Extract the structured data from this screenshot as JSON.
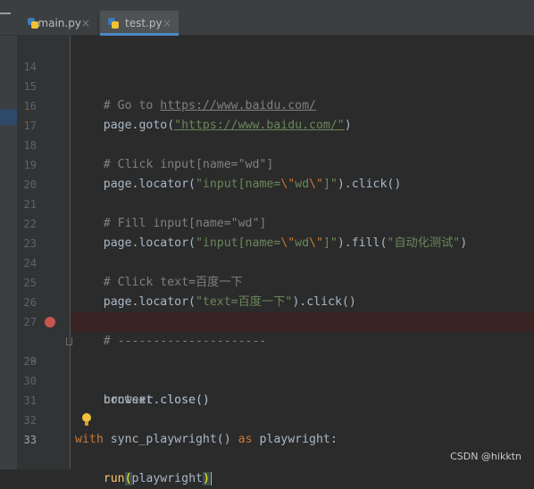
{
  "tabs": [
    {
      "label": "main.py",
      "close": "×",
      "icon": "python-file-icon"
    },
    {
      "label": "test.py",
      "close": "×",
      "icon": "python-file-icon",
      "active": true
    }
  ],
  "editor": {
    "line_numbers": [
      "14",
      "15",
      "16",
      "17",
      "18",
      "19",
      "20",
      "21",
      "22",
      "23",
      "24",
      "25",
      "26",
      "27",
      "28",
      "29",
      "30",
      "31",
      "32",
      "33"
    ],
    "current_line": "33",
    "breakpoint_line": "28",
    "lines": {
      "l15": {
        "prefix": "    # Go to ",
        "url": "https://www.baidu.com/"
      },
      "l16": {
        "prefix": "    page.goto(",
        "url": "\"https://www.baidu.com/\"",
        "suffix": ")"
      },
      "l18": {
        "comment": "    # Click input[name=\"wd\"]"
      },
      "l19": {
        "prefix": "    page.locator(",
        "s1": "\"input[name=",
        "e1": "\\\"",
        "s2": "wd",
        "e2": "\\\"",
        "s3": "]\"",
        "suffix": ").click()"
      },
      "l21": {
        "comment": "    # Fill input[name=\"wd\"]"
      },
      "l22": {
        "prefix": "    page.locator(",
        "s1": "\"input[name=",
        "e1": "\\\"",
        "s2": "wd",
        "e2": "\\\"",
        "s3": "]\"",
        "mid": ").fill(",
        "s4": "\"自动化测试\"",
        "suffix": ")"
      },
      "l24": {
        "comment": "    # Click text=百度一下"
      },
      "l25": {
        "prefix": "    page.locator(",
        "s1": "\"text=百度一下\"",
        "suffix": ").click()"
      },
      "l27": {
        "comment": "    # ---------------------"
      },
      "l28": {
        "code": "    context.close()"
      },
      "l29": {
        "code": "    browser.close()"
      },
      "l32": {
        "kw1": "with",
        "mid1": " sync_playwright() ",
        "kw2": "as",
        "mid2": " playwright:"
      },
      "l33": {
        "prefix": "    ",
        "fn": "run",
        "open": "(",
        "arg": "playwright",
        "close": ")"
      }
    }
  },
  "watermark": "CSDN @hikktn",
  "colors": {
    "background": "#2b2b2b",
    "gutter": "#313335",
    "comment": "#808080",
    "string": "#6a8759",
    "keyword": "#cc7832",
    "function": "#ffc66d",
    "breakpoint": "#c75450",
    "active_tab_underline": "#4a88c7"
  }
}
